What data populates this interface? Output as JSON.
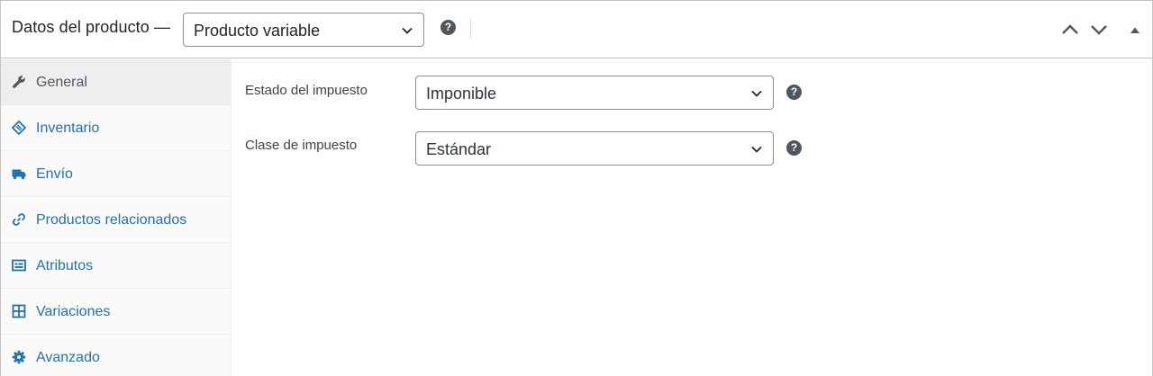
{
  "header": {
    "title": "Datos del producto —",
    "product_type": {
      "value": "Producto variable"
    },
    "help_glyph": "?",
    "buttons": [
      "move-up-icon",
      "move-down-icon",
      "toggle-panel-icon"
    ]
  },
  "sidebar": {
    "active_index": 0,
    "items": [
      {
        "label": "General",
        "icon": "wrench-icon"
      },
      {
        "label": "Inventario",
        "icon": "tag-icon"
      },
      {
        "label": "Envío",
        "icon": "truck-icon"
      },
      {
        "label": "Productos relacionados",
        "icon": "link-icon"
      },
      {
        "label": "Atributos",
        "icon": "list-card-icon"
      },
      {
        "label": "Variaciones",
        "icon": "grid-icon"
      },
      {
        "label": "Avanzado",
        "icon": "gear-icon"
      }
    ]
  },
  "main": {
    "tax_status": {
      "label": "Estado del impuesto",
      "value": "Imponible"
    },
    "tax_class": {
      "label": "Clase de impuesto",
      "value": "Estándar"
    }
  },
  "colors": {
    "link": "#2271b1",
    "active_text": "#50575e",
    "help_bg": "#50575e",
    "border": "#c3c4c7"
  }
}
